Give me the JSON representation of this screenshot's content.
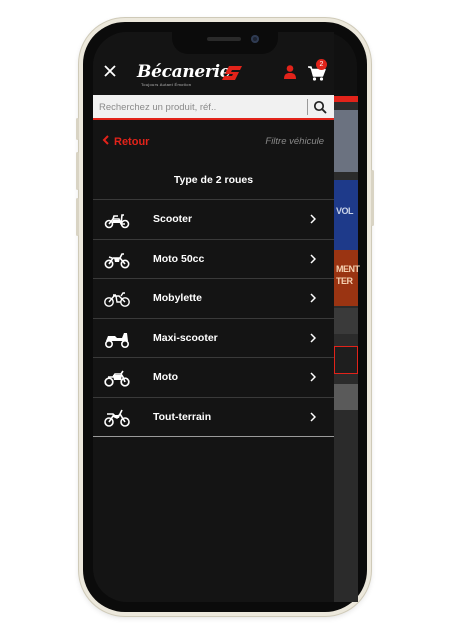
{
  "header": {
    "logo_text": "Bécanerie",
    "logo_tagline": "Toujours Autant Émotion",
    "cart_count": "2",
    "accent_color": "#e2231a"
  },
  "search": {
    "placeholder": "Recherchez un produit, réf.."
  },
  "nav": {
    "back_label": "Retour",
    "filter_label": "Filtre véhicule"
  },
  "section": {
    "title": "Type de 2 roues"
  },
  "vehicle_types": [
    {
      "label": "Scooter",
      "icon": "scooter-icon"
    },
    {
      "label": "Moto 50cc",
      "icon": "moto-50cc-icon"
    },
    {
      "label": "Mobylette",
      "icon": "mobylette-icon"
    },
    {
      "label": "Maxi-scooter",
      "icon": "maxi-scooter-icon"
    },
    {
      "label": "Moto",
      "icon": "moto-icon"
    },
    {
      "label": "Tout-terrain",
      "icon": "tout-terrain-icon"
    }
  ],
  "background_page": {
    "text_1": "VOL",
    "text_2": "MENT",
    "text_3": "TER"
  }
}
